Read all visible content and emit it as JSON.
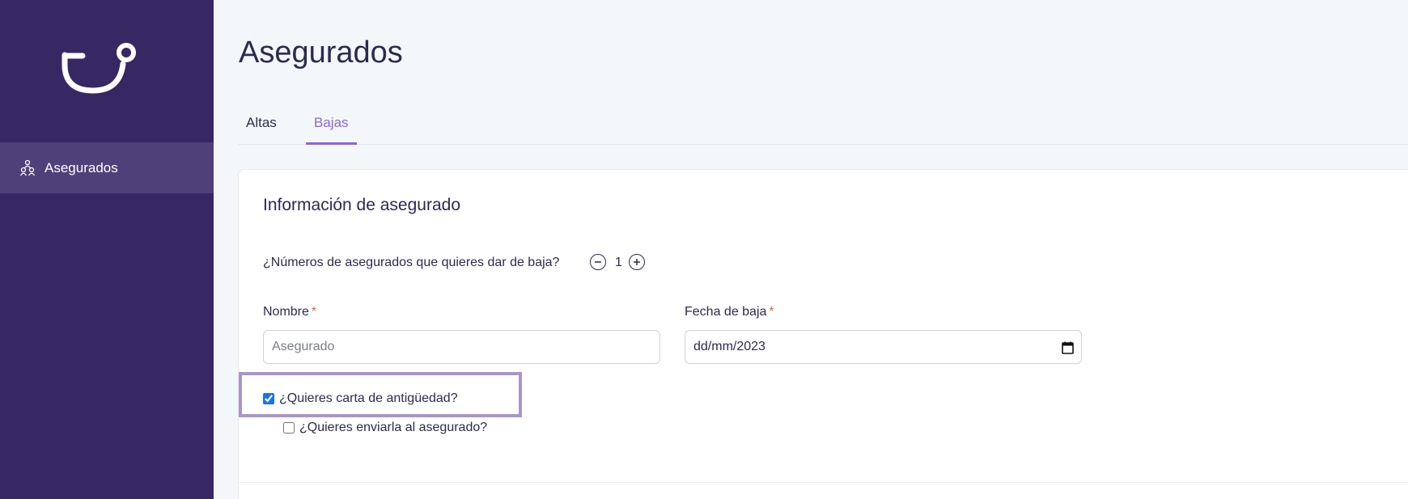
{
  "sidebar": {
    "logo_icon": "tui-smile-logo",
    "items": [
      {
        "label": "Asegurados",
        "icon": "users-icon",
        "active": true
      }
    ]
  },
  "page": {
    "title": "Asegurados"
  },
  "tabs": [
    {
      "label": "Altas",
      "active": false
    },
    {
      "label": "Bajas",
      "active": true
    }
  ],
  "card": {
    "title": "Información de asegurado",
    "count_question": "¿Números de asegurados que quieres dar de baja?",
    "count_value": "1",
    "nombre": {
      "label": "Nombre",
      "required": "*",
      "placeholder": "Asegurado",
      "value": ""
    },
    "fecha": {
      "label": "Fecha de baja",
      "required": "*",
      "value": "dd/mm/2023"
    },
    "checkboxes": [
      {
        "label": "¿Quieres carta de antigüedad?",
        "checked": true
      },
      {
        "label": "¿Quieres enviarla al asegurado?",
        "checked": false
      }
    ]
  },
  "colors": {
    "sidebar_bg": "#362863",
    "sidebar_active_bg": "#4e4179",
    "accent": "#8a64e0",
    "highlight_border": "#a996c9",
    "required": "#e0643c"
  }
}
